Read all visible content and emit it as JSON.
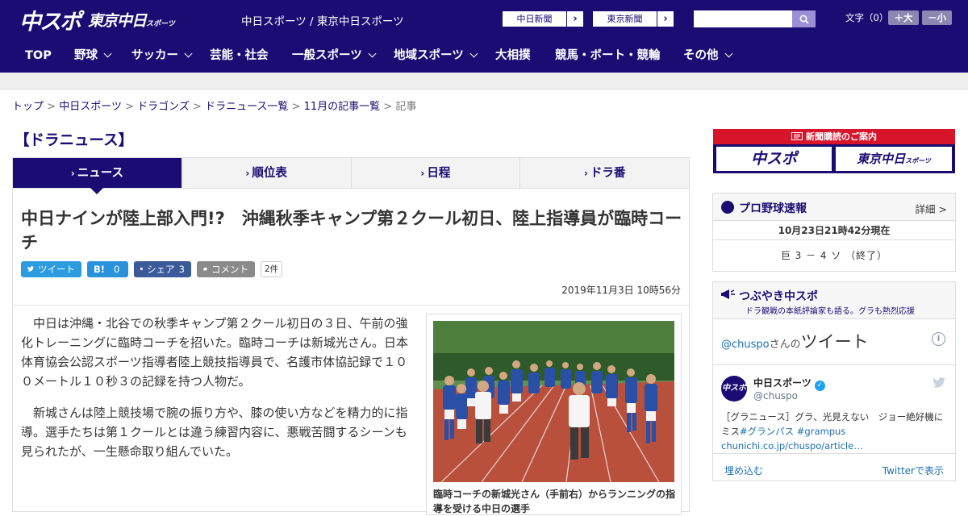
{
  "header": {
    "logo_chuspo": "中スポ",
    "logo_tokyo": "東京中日",
    "logo_tokyo_small": "スポーツ",
    "site_title": "中日スポーツ / 東京中日スポーツ",
    "paper_links": [
      "中日新聞",
      "東京新聞"
    ],
    "search_placeholder": "",
    "font_label": "文字（0）",
    "font_larger": "＋大",
    "font_smaller": "－小"
  },
  "nav": [
    {
      "label": "TOP",
      "has_menu": false
    },
    {
      "label": "野球",
      "has_menu": true
    },
    {
      "label": "サッカー",
      "has_menu": true
    },
    {
      "label": "芸能・社会",
      "has_menu": false
    },
    {
      "label": "一般スポーツ",
      "has_menu": true
    },
    {
      "label": "地域スポーツ",
      "has_menu": true
    },
    {
      "label": "大相撲",
      "has_menu": false
    },
    {
      "label": "競馬・ボート・競輪",
      "has_menu": false
    },
    {
      "label": "その他",
      "has_menu": true
    }
  ],
  "breadcrumb": {
    "links": [
      "トップ",
      "中日スポーツ",
      "ドラゴンズ",
      "ドラニュース一覧",
      "11月の記事一覧"
    ],
    "current": "記事",
    "sep": ">"
  },
  "section_title": "【ドラニュース】",
  "tabs": [
    {
      "label": "ニュース",
      "active": true
    },
    {
      "label": "順位表",
      "active": false
    },
    {
      "label": "日程",
      "active": false
    },
    {
      "label": "ドラ番",
      "active": false
    }
  ],
  "article": {
    "headline": "中日ナインが陸上部入門!?　沖縄秋季キャンプ第２クール初日、陸上指導員が臨時コーチ",
    "share": {
      "tweet": "ツイート",
      "hatena_mark": "B!",
      "hatena_count": "0",
      "facebook": "シェア",
      "facebook_count": "3",
      "comment": "コメント",
      "comment_count": "2件"
    },
    "date": "2019年11月3日 10時56分",
    "paragraphs": [
      "中日は沖縄・北谷での秋季キャンプ第２クール初日の３日、午前の強化トレーニングに臨時コーチを招いた。臨時コーチは新城光さん。日本体育協会公認スポーツ指導者陸上競技指導員で、名護市体協記録で１００メートル１０秒３の記録を持つ人物だ。",
      "新城さんは陸上競技場で腕の振り方や、膝の使い方などを精力的に指導。選手たちは第１クールとは違う練習内容に、悪戦苦闘するシーンも見られたが、一生懸命取り組んでいた。"
    ],
    "caption": "臨時コーチの新城光さん（手前右）からランニングの指導を受ける中日の選手"
  },
  "sidebar": {
    "subscribe": {
      "title": "新聞購読のご案内",
      "logo1": "中スポ",
      "logo2": "東京中日",
      "logo2_small": "スポーツ"
    },
    "baseball": {
      "title": "プロ野球速報",
      "more": "詳細 >",
      "time": "10月23日21時42分現在",
      "score": "巨 3 － 4 ソ （終了）"
    },
    "tweets": {
      "title": "つぶやき中スポ",
      "subtitle": "ドラ観戦の本紙評論家も語る。グラも熱烈応援",
      "handle": "@chuspo",
      "handle_suffix": "さんの",
      "handle_big": "ツイート",
      "info_icon": "i",
      "avatar_text": "中スポ",
      "name": "中日スポーツ",
      "verified_mark": "✓",
      "user": "@chuspo",
      "text_plain": "［グラニュース］グラ、光見えない　ジョー絶好機にミス",
      "hashtag1": "#グランパス",
      "hashtag2": "#grampus",
      "link": "chunichi.co.jp/chuspo/article…",
      "embed": "埋め込む",
      "view": "Twitterで表示"
    }
  }
}
